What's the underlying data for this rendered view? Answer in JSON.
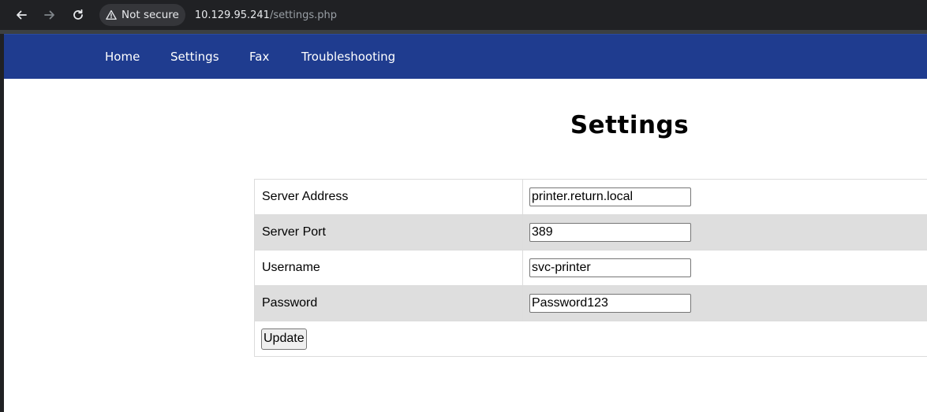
{
  "browser": {
    "security_label": "Not secure",
    "url_host": "10.129.95.241",
    "url_path": "/settings.php"
  },
  "nav": {
    "items": [
      {
        "label": "Home"
      },
      {
        "label": "Settings"
      },
      {
        "label": "Fax"
      },
      {
        "label": "Troubleshooting"
      }
    ]
  },
  "page": {
    "title": "Settings"
  },
  "form": {
    "rows": [
      {
        "label": "Server Address",
        "value": "printer.return.local"
      },
      {
        "label": "Server Port",
        "value": "389"
      },
      {
        "label": "Username",
        "value": "svc-printer"
      },
      {
        "label": "Password",
        "value": "Password123"
      }
    ],
    "submit_label": "Update"
  },
  "colors": {
    "navbar": "#1f3c8f",
    "row_shade": "#dedede",
    "chrome": "#202124"
  },
  "icons": {
    "back": "back-arrow-icon",
    "forward": "forward-arrow-icon",
    "reload": "reload-icon",
    "warning": "warning-triangle-icon"
  }
}
